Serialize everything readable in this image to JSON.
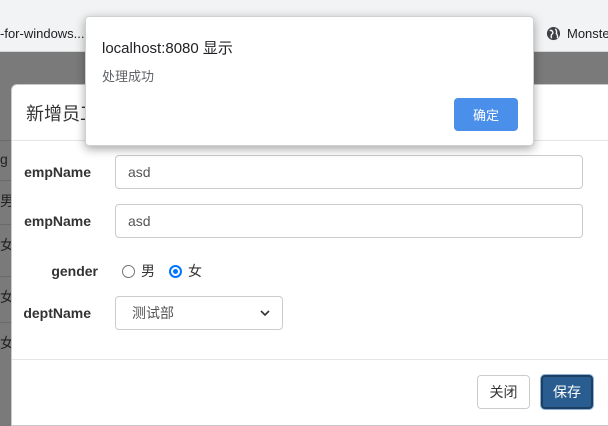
{
  "browser": {
    "bookmark_left": "-for-windows...",
    "bookmark_right": "Monste"
  },
  "background_rows": [
    "g",
    "男",
    "女",
    "女",
    "女"
  ],
  "modal": {
    "title": "新增员工",
    "fields": {
      "emp_name_label_1": "empName",
      "emp_name_value_1": "asd",
      "emp_name_label_2": "empName",
      "emp_name_value_2": "asd",
      "gender_label": "gender",
      "gender_option_male": "男",
      "gender_option_female": "女",
      "gender_selected": "女",
      "dept_label": "deptName",
      "dept_selected": "测试部"
    },
    "close_button": "关闭",
    "save_button": "保存"
  },
  "alert": {
    "title": "localhost:8080 显示",
    "message": "处理成功",
    "ok_button": "确定"
  }
}
